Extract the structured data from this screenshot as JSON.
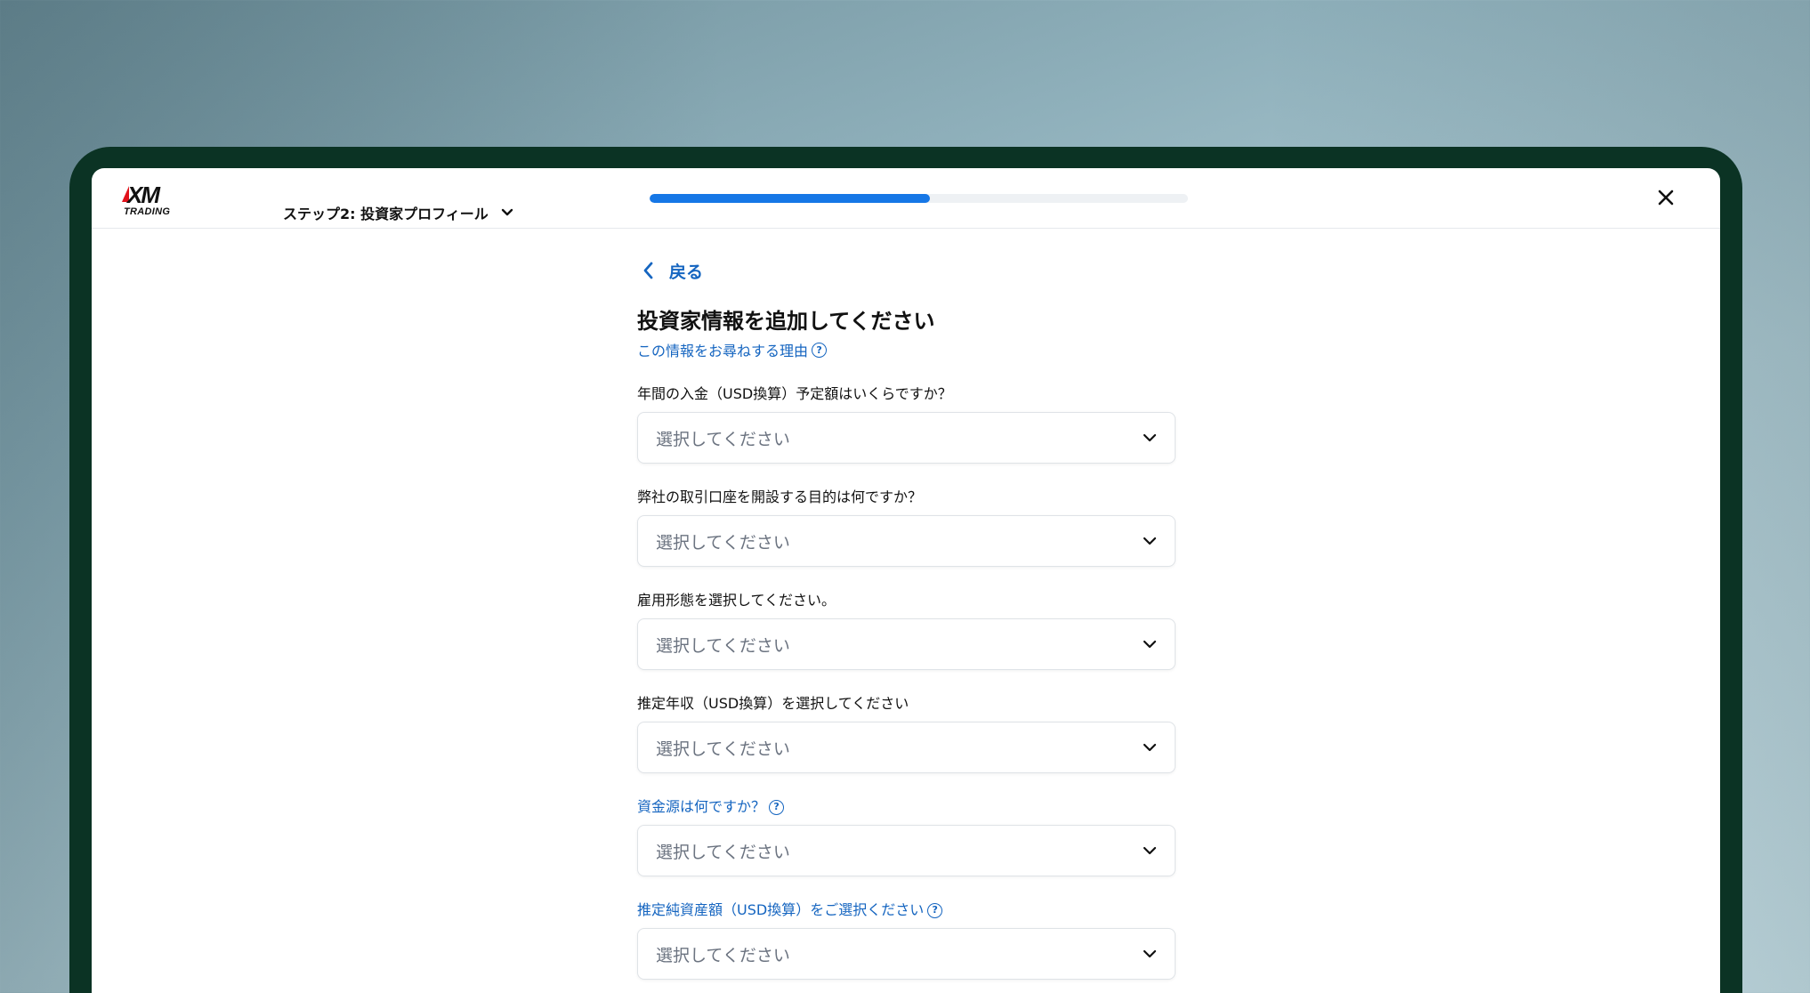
{
  "header": {
    "logo_text": "XM",
    "logo_sub": "TRADING",
    "step_label": "ステップ2: 投資家プロフィール",
    "progress_percent": 52
  },
  "form": {
    "back_label": "戻る",
    "title": "投資家情報を追加してください",
    "why_link": "この情報をお尋ねする理由",
    "fields": [
      {
        "label": "年間の入金（USD換算）予定額はいくらですか？",
        "placeholder": "選択してください"
      },
      {
        "label": "弊社の取引口座を開設する目的は何ですか？",
        "placeholder": "選択してください"
      },
      {
        "label": "雇用形態を選択してください。",
        "placeholder": "選択してください"
      },
      {
        "label": "推定年収（USD換算）を選択してください",
        "placeholder": "選択してください"
      },
      {
        "label": "資金源は何ですか？",
        "placeholder": "選択してください"
      },
      {
        "label": "推定純資産額（USD換算）をご選択ください",
        "placeholder": "選択してください"
      }
    ]
  },
  "colors": {
    "accent": "#1677e6",
    "link": "#1565c0",
    "device_frame": "#0b3324"
  }
}
